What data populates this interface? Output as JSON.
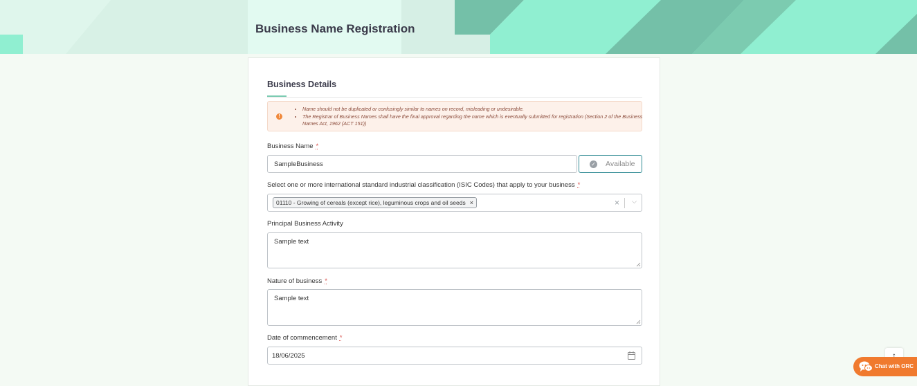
{
  "header": {
    "title": "Business Name Registration"
  },
  "form": {
    "section_tab": "Business Details",
    "notice": {
      "icon": "exclamation-circle-icon",
      "items": [
        "Name should not be duplicated or confusingly similar to names on record, misleading or undesirable.",
        "The Registrar of Business Names shall have the final approval regarding the name which is eventually submitted for registration (Section 2 of the Business Names Act, 1962 (ACT 151))"
      ]
    },
    "business_name": {
      "label": "Business Name",
      "required_mark": "*",
      "value": "SampleBusiness",
      "availability_label": "Available"
    },
    "isic": {
      "label": "Select one or more international standard industrial classification (ISIC Codes) that apply to your business",
      "required_mark": "*",
      "selected": [
        "01110 - Growing of cereals (except rice), leguminous crops and oil seeds"
      ],
      "chip_remove": "×",
      "clear": "×",
      "chevron": "⌵"
    },
    "principal_activity": {
      "label": "Principal Business Activity",
      "value": "Sample text"
    },
    "nature": {
      "label": "Nature of business",
      "required_mark": "*",
      "value": "Sample text"
    },
    "commencement": {
      "label": "Date of commencement",
      "required_mark": "*",
      "value": "18/06/2025"
    }
  },
  "scroll_top": {
    "icon": "arrow-up-icon",
    "symbol": "↑"
  },
  "chat": {
    "label": "Chat with ORC",
    "icon": "chat-bubbles-icon"
  },
  "colors": {
    "accent": "#7ccbb2",
    "banner_dark": "#74c0a8",
    "banner_light": "#90efd1",
    "chat": "#f07a2e",
    "required": "#d9534f"
  }
}
